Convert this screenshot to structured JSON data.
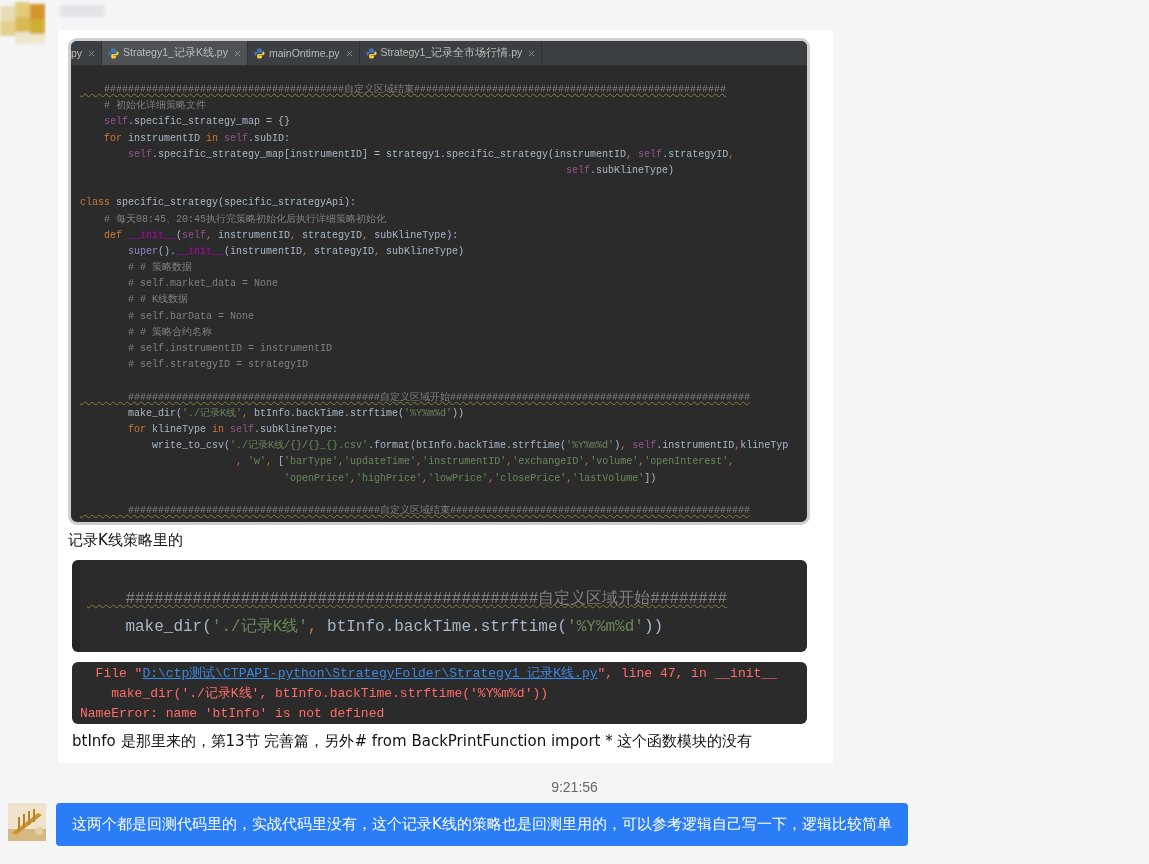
{
  "incoming": {
    "name_blurred": true,
    "parts": [
      {
        "kind": "editor",
        "tabs": [
          {
            "label": "py",
            "selected": false,
            "partial": true
          },
          {
            "label": "Strategy1_记录K线.py",
            "selected": true,
            "partial": false
          },
          {
            "label": "mainOntime.py",
            "selected": false,
            "partial": false
          },
          {
            "label": "Strategy1_记录全市场行情.py",
            "selected": false,
            "partial": false
          }
        ],
        "lines": [
          {
            "kind": "code",
            "tokens": [
              {
                "kind": "hashbar",
                "text": "    ########################################自定义区域结束####################################################"
              }
            ]
          },
          {
            "kind": "code",
            "tokens": [
              {
                "kind": "comment",
                "text": "    # 初始化详细策略文件"
              }
            ]
          },
          {
            "kind": "code",
            "tokens": [
              {
                "kind": "self",
                "text": "    self"
              },
              {
                "kind": "plain",
                "text": ".specific_strategy_map = {}"
              }
            ]
          },
          {
            "kind": "code",
            "tokens": [
              {
                "kind": "keyword",
                "text": "    for "
              },
              {
                "kind": "plain",
                "text": "instrumentID "
              },
              {
                "kind": "keyword",
                "text": "in "
              },
              {
                "kind": "self",
                "text": "self"
              },
              {
                "kind": "plain",
                "text": ".subID:"
              }
            ]
          },
          {
            "kind": "code",
            "tokens": [
              {
                "kind": "self",
                "text": "        self"
              },
              {
                "kind": "plain",
                "text": ".specific_strategy_map[instrumentID] = strategy1.specific_strategy(instrumentID"
              },
              {
                "kind": "keyword",
                "text": ", "
              },
              {
                "kind": "self",
                "text": "self"
              },
              {
                "kind": "plain",
                "text": ".strategyID"
              },
              {
                "kind": "keyword",
                "text": ","
              }
            ]
          },
          {
            "kind": "code",
            "tokens": [
              {
                "kind": "self",
                "text": "                                                                                 self"
              },
              {
                "kind": "plain",
                "text": ".subKlineType)"
              }
            ]
          },
          {
            "kind": "blank"
          },
          {
            "kind": "code",
            "tokens": [
              {
                "kind": "keyword",
                "text": "class "
              },
              {
                "kind": "plain",
                "text": "specific_strategy(specific_strategyApi):"
              }
            ]
          },
          {
            "kind": "code",
            "tokens": [
              {
                "kind": "comment",
                "text": "    # 每天08:45、20:45执行完策略初始化后执行详细策略初始化"
              }
            ]
          },
          {
            "kind": "code",
            "tokens": [
              {
                "kind": "keyword",
                "text": "    def "
              },
              {
                "kind": "magic",
                "text": "__init__"
              },
              {
                "kind": "plain",
                "text": "("
              },
              {
                "kind": "self",
                "text": "self"
              },
              {
                "kind": "keyword",
                "text": ", "
              },
              {
                "kind": "plain",
                "text": "instrumentID"
              },
              {
                "kind": "keyword",
                "text": ", "
              },
              {
                "kind": "plain",
                "text": "strategyID"
              },
              {
                "kind": "keyword",
                "text": ", "
              },
              {
                "kind": "plain",
                "text": "subKlineType):"
              }
            ]
          },
          {
            "kind": "code",
            "tokens": [
              {
                "kind": "builtin",
                "text": "        super"
              },
              {
                "kind": "plain",
                "text": "()."
              },
              {
                "kind": "magic",
                "text": "__init__"
              },
              {
                "kind": "plain",
                "text": "(instrumentID"
              },
              {
                "kind": "keyword",
                "text": ", "
              },
              {
                "kind": "plain",
                "text": "strategyID"
              },
              {
                "kind": "keyword",
                "text": ", "
              },
              {
                "kind": "plain",
                "text": "subKlineType)"
              }
            ]
          },
          {
            "kind": "code",
            "tokens": [
              {
                "kind": "comment",
                "text": "        # # 策略数据"
              }
            ]
          },
          {
            "kind": "code",
            "tokens": [
              {
                "kind": "comment",
                "text": "        # self.market_data = None"
              }
            ]
          },
          {
            "kind": "code",
            "tokens": [
              {
                "kind": "comment",
                "text": "        # # K线数据"
              }
            ]
          },
          {
            "kind": "code",
            "tokens": [
              {
                "kind": "comment",
                "text": "        # self.barData = None"
              }
            ]
          },
          {
            "kind": "code",
            "tokens": [
              {
                "kind": "comment",
                "text": "        # # 策略合约名称"
              }
            ]
          },
          {
            "kind": "code",
            "tokens": [
              {
                "kind": "comment",
                "text": "        # self.instrumentID = instrumentID"
              }
            ]
          },
          {
            "kind": "code",
            "tokens": [
              {
                "kind": "comment",
                "text": "        # self.strategyID = strategyID"
              }
            ]
          },
          {
            "kind": "blank"
          },
          {
            "kind": "code",
            "tokens": [
              {
                "kind": "hashbar",
                "text": "        ##########################################自定义区域开始##################################################"
              }
            ]
          },
          {
            "kind": "code",
            "tokens": [
              {
                "kind": "plain",
                "text": "        make_dir("
              },
              {
                "kind": "string",
                "text": "'./记录K线'"
              },
              {
                "kind": "keyword",
                "text": ", "
              },
              {
                "kind": "plain",
                "text": "btInfo.backTime.strftime("
              },
              {
                "kind": "string",
                "text": "'%Y%m%d'"
              },
              {
                "kind": "plain",
                "text": "))"
              }
            ]
          },
          {
            "kind": "code",
            "tokens": [
              {
                "kind": "keyword",
                "text": "        for "
              },
              {
                "kind": "plain",
                "text": "klineType "
              },
              {
                "kind": "keyword",
                "text": "in "
              },
              {
                "kind": "self",
                "text": "self"
              },
              {
                "kind": "plain",
                "text": ".subKlineType:"
              }
            ]
          },
          {
            "kind": "code",
            "tokens": [
              {
                "kind": "plain",
                "text": "            write_to_csv("
              },
              {
                "kind": "string",
                "text": "'./记录K线/{}/{}_{}.csv'"
              },
              {
                "kind": "plain",
                "text": ".format(btInfo.backTime.strftime("
              },
              {
                "kind": "string",
                "text": "'%Y%m%d'"
              },
              {
                "kind": "plain",
                "text": ")"
              },
              {
                "kind": "keyword",
                "text": ", "
              },
              {
                "kind": "self",
                "text": "self"
              },
              {
                "kind": "plain",
                "text": ".instrumentID"
              },
              {
                "kind": "keyword",
                "text": ","
              },
              {
                "kind": "plain",
                "text": "klineTyp"
              }
            ]
          },
          {
            "kind": "code",
            "tokens": [
              {
                "kind": "keyword",
                "text": "                          , "
              },
              {
                "kind": "string",
                "text": "'w'"
              },
              {
                "kind": "keyword",
                "text": ", "
              },
              {
                "kind": "plain",
                "text": "["
              },
              {
                "kind": "string",
                "text": "'barType'"
              },
              {
                "kind": "keyword",
                "text": ","
              },
              {
                "kind": "string",
                "text": "'updateTime'"
              },
              {
                "kind": "keyword",
                "text": ","
              },
              {
                "kind": "string",
                "text": "'instrumentID'"
              },
              {
                "kind": "keyword",
                "text": ","
              },
              {
                "kind": "string",
                "text": "'exchangeID'"
              },
              {
                "kind": "keyword",
                "text": ","
              },
              {
                "kind": "string",
                "text": "'volume'"
              },
              {
                "kind": "keyword",
                "text": ","
              },
              {
                "kind": "string",
                "text": "'openInterest'"
              },
              {
                "kind": "keyword",
                "text": ","
              }
            ]
          },
          {
            "kind": "code",
            "tokens": [
              {
                "kind": "string",
                "text": "                                  'openPrice'"
              },
              {
                "kind": "keyword",
                "text": ","
              },
              {
                "kind": "string",
                "text": "'highPrice'"
              },
              {
                "kind": "keyword",
                "text": ","
              },
              {
                "kind": "string",
                "text": "'lowPrice'"
              },
              {
                "kind": "keyword",
                "text": ","
              },
              {
                "kind": "string",
                "text": "'closePrice'"
              },
              {
                "kind": "keyword",
                "text": ","
              },
              {
                "kind": "string",
                "text": "'lastVolume'"
              },
              {
                "kind": "plain",
                "text": "])"
              }
            ]
          },
          {
            "kind": "blank"
          },
          {
            "kind": "code",
            "tokens": [
              {
                "kind": "hashbar",
                "text": "        ##########################################自定义区域结束##################################################"
              }
            ]
          }
        ]
      },
      {
        "kind": "text",
        "text": "记录K线策略里的"
      },
      {
        "kind": "snippet",
        "lines": [
          {
            "kind": "code",
            "tokens": [
              {
                "kind": "hashbar",
                "text": "    ###########################################自定义区域开始########"
              }
            ]
          },
          {
            "kind": "code",
            "tokens": [
              {
                "kind": "plain",
                "text": "    make_dir("
              },
              {
                "kind": "string",
                "text": "'./记录K线'"
              },
              {
                "kind": "keyword",
                "text": ", "
              },
              {
                "kind": "plain",
                "text": "btInfo.backTime.strftime("
              },
              {
                "kind": "string",
                "text": "'%Y%m%d'"
              },
              {
                "kind": "plain",
                "text": "))"
              }
            ]
          }
        ]
      },
      {
        "kind": "traceback",
        "lines": [
          {
            "kind": "file",
            "prefix": "  File \"",
            "link": "D:\\ctp测试\\CTPAPI-python\\StrategyFolder\\Strategy1_记录K线.py",
            "suffix": "\", line 47, in __init__"
          },
          {
            "kind": "plain",
            "text": "    make_dir('./记录K线', btInfo.backTime.strftime('%Y%m%d'))"
          },
          {
            "kind": "plain",
            "text": "NameError: name 'btInfo' is not defined"
          }
        ]
      },
      {
        "kind": "text",
        "text": "btInfo 是那里来的，第13节 完善篇，另外# from BackPrintFunction import * 这个函数模块的没有"
      }
    ]
  },
  "timestamp": "9:21:56",
  "outgoing": {
    "text": "这两个都是回测代码里的，实战代码里没有，这个记录K线的策略也是回测里用的，可以参考逻辑自己写一下，逻辑比较简单"
  }
}
